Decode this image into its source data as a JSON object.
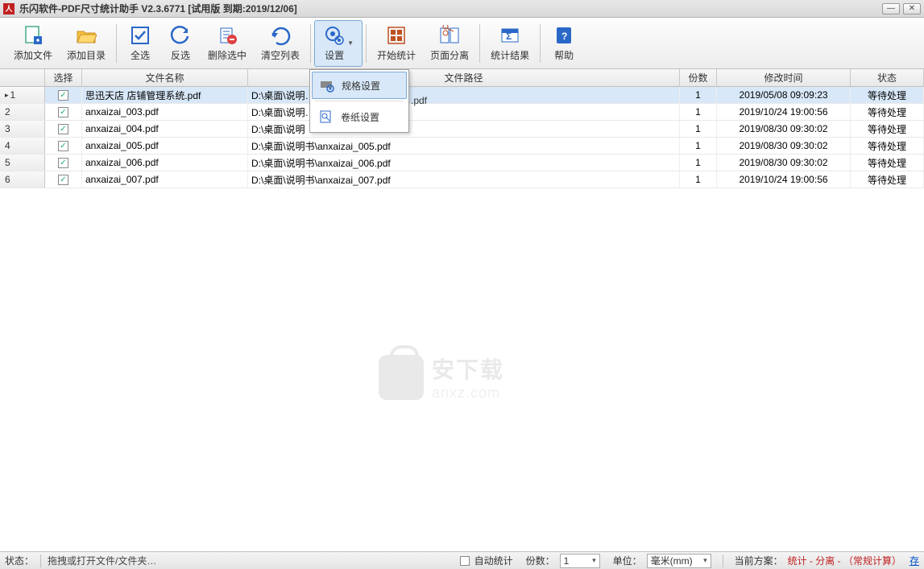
{
  "window": {
    "title": "乐闪软件-PDF尺寸统计助手  V2.3.6771 [试用版 到期:2019/12/06]"
  },
  "toolbar": {
    "add_file": "添加文件",
    "add_dir": "添加目录",
    "select_all": "全选",
    "invert": "反选",
    "delete_sel": "删除选中",
    "clear_list": "清空列表",
    "settings": "设置",
    "start_stat": "开始统计",
    "page_split": "页面分离",
    "stat_result": "统计结果",
    "help": "帮助"
  },
  "settings_menu": {
    "spec": "规格设置",
    "roll": "卷纸设置"
  },
  "columns": {
    "select": "选择",
    "name": "文件名称",
    "path": "文件路径",
    "copies": "份数",
    "mtime": "修改时间",
    "status": "状态"
  },
  "rows": [
    {
      "n": "1",
      "name": "思迅天店 店铺管理系统.pdf",
      "path": "D:\\桌面\\说明……",
      "copies": "1",
      "mtime": "2019/05/08 09:09:23",
      "status": "等待处理",
      "sel": true
    },
    {
      "n": "2",
      "name": "anxaizai_003.pdf",
      "path": "D:\\桌面\\说明……",
      "copies": "1",
      "mtime": "2019/10/24 19:00:56",
      "status": "等待处理"
    },
    {
      "n": "3",
      "name": "anxaizai_004.pdf",
      "path": "D:\\桌面\\说明书\\anxaizai_004.pdf",
      "path_overlay": true,
      "path_short": "D:\\桌面\\说明",
      "copies": "1",
      "mtime": "2019/08/30 09:30:02",
      "status": "等待处理"
    },
    {
      "n": "4",
      "name": "anxaizai_005.pdf",
      "path": "D:\\桌面\\说明书\\anxaizai_005.pdf",
      "copies": "1",
      "mtime": "2019/08/30 09:30:02",
      "status": "等待处理"
    },
    {
      "n": "5",
      "name": "anxaizai_006.pdf",
      "path": "D:\\桌面\\说明书\\anxaizai_006.pdf",
      "copies": "1",
      "mtime": "2019/08/30 09:30:02",
      "status": "等待处理"
    },
    {
      "n": "6",
      "name": "anxaizai_007.pdf",
      "path": "D:\\桌面\\说明书\\anxaizai_007.pdf",
      "copies": "1",
      "mtime": "2019/10/24 19:00:56",
      "status": "等待处理"
    }
  ],
  "row1_path_tail": ".pdf",
  "watermark": {
    "line1": "安下载",
    "line2": "anxz.com"
  },
  "statusbar": {
    "state": "状态：",
    "hint": "拖拽或打开文件/文件夹…",
    "auto_stat": "自动统计",
    "copies_label": "份数：",
    "copies_value": "1",
    "unit_label": "单位：",
    "unit_value": "毫米(mm)",
    "scheme_label": "当前方案：",
    "scheme_value": "统计 - 分离 - （常规计算）",
    "scheme_link": "存"
  }
}
